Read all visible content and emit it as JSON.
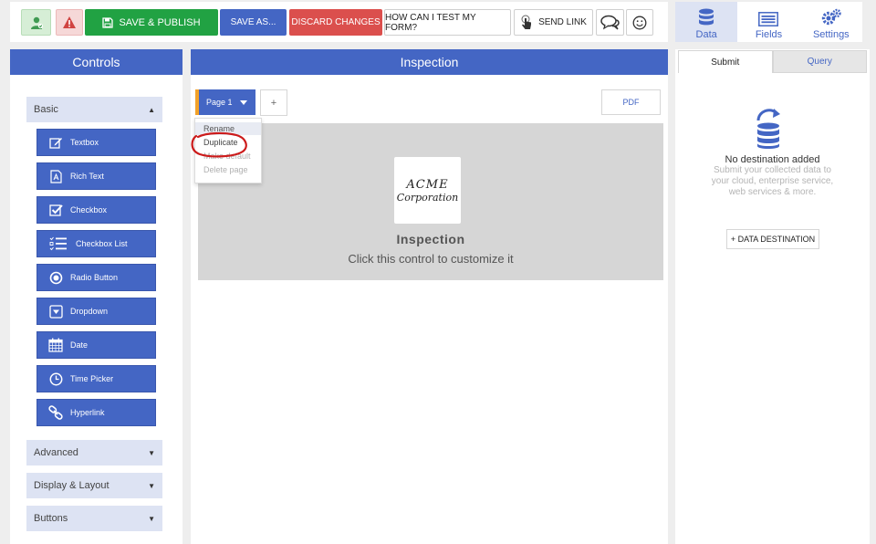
{
  "toolbar": {
    "save_publish": "SAVE & PUBLISH",
    "save_as": "SAVE AS...",
    "discard": "DISCARD CHANGES",
    "how_test": "HOW CAN I TEST MY FORM?",
    "send_link": "SEND LINK",
    "icons": [
      "user-icon",
      "warning-icon",
      "floppy-disk-icon",
      "touch-pointer-icon",
      "chat-bubbles-icon",
      "smiley-icon"
    ]
  },
  "right_tabs": [
    {
      "label": "Data",
      "icon": "database-icon",
      "active": true
    },
    {
      "label": "Fields",
      "icon": "list-icon",
      "active": false
    },
    {
      "label": "Settings",
      "icon": "gears-icon",
      "active": false
    }
  ],
  "controls": {
    "title": "Controls",
    "sections": {
      "basic": "Basic",
      "advanced": "Advanced",
      "display_layout": "Display & Layout",
      "buttons": "Buttons"
    },
    "items": [
      {
        "label": "Textbox",
        "icon": "edit-icon"
      },
      {
        "label": "Rich Text",
        "icon": "rich-text-icon"
      },
      {
        "label": "Checkbox",
        "icon": "checkbox-icon"
      },
      {
        "label": "Checkbox List",
        "icon": "checklist-icon"
      },
      {
        "label": "Radio Button",
        "icon": "radio-icon"
      },
      {
        "label": "Dropdown",
        "icon": "dropdown-icon"
      },
      {
        "label": "Date",
        "icon": "calendar-icon"
      },
      {
        "label": "Time Picker",
        "icon": "clock-icon"
      },
      {
        "label": "Hyperlink",
        "icon": "link-icon"
      }
    ]
  },
  "inspection": {
    "title": "Inspection",
    "page_tab": "Page 1",
    "add_page": "+",
    "pdf": "PDF",
    "menu": {
      "rename": "Rename",
      "duplicate": "Duplicate",
      "make_default": "Make default",
      "delete_page": "Delete page"
    },
    "logo_line1": "ACME",
    "logo_line2": "Corporation",
    "canvas_title": "Inspection",
    "canvas_subtitle": "Click this control to customize it"
  },
  "data_panel": {
    "tabs": {
      "submit": "Submit",
      "query": "Query"
    },
    "empty_title": "No destination added",
    "empty_desc": "Submit your collected data to your cloud, enterprise service, web services & more.",
    "add_button": "+ DATA DESTINATION"
  },
  "colors": {
    "primary": "#4466c4",
    "green": "#21a243",
    "red": "#db4f4d",
    "orange_marker": "#f2a229",
    "annotation_red": "#cc1b1b"
  }
}
